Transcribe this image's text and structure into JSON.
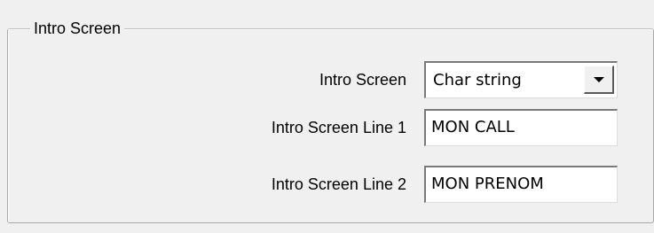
{
  "group": {
    "title": "Intro Screen"
  },
  "fields": {
    "intro_screen": {
      "label": "Intro Screen",
      "value": "Char string"
    },
    "line1": {
      "label": "Intro Screen Line 1",
      "value": "MON CALL"
    },
    "line2": {
      "label": "Intro Screen Line 2",
      "value": "MON PRENOM"
    }
  },
  "icons": {
    "dropdown": "chevron-down-icon"
  }
}
